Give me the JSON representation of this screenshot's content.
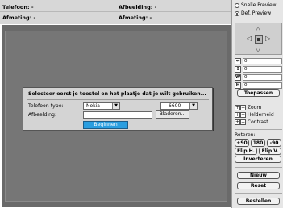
{
  "header": {
    "telefoon_label": "Telefoon: -",
    "afbeelding_label": "Afbeelding: -",
    "afmeting_label": "Afmeting: -",
    "afmeting2_label": "Afmeting: -"
  },
  "dialog": {
    "title": "Selecteer eerst je toestel en het plaatje dat je wilt gebruiken...",
    "type_label": "Telefoon type:",
    "brand_value": "Nokia",
    "model_value": "6600",
    "image_label": "Afbeelding:",
    "image_value": "",
    "browse_label": "Bladeren...",
    "start_label": "Beginnen"
  },
  "panel": {
    "preview_options": [
      {
        "label": "Snelle Preview",
        "selected": false
      },
      {
        "label": "Def. Preview",
        "selected": true
      }
    ],
    "nav_icons": [
      "arrow-up-icon",
      "arrow-left-icon",
      "center-icon",
      "arrow-right-icon",
      "arrow-down-icon"
    ],
    "dims": [
      {
        "icon": "↔",
        "name": "width-offset-icon",
        "value": "0"
      },
      {
        "icon": "↕",
        "name": "height-offset-icon",
        "value": "0"
      },
      {
        "icon": "W",
        "name": "width-icon",
        "value": "0"
      },
      {
        "icon": "H",
        "name": "height-icon",
        "value": "0"
      }
    ],
    "apply_label": "Toepassen",
    "adjust": [
      {
        "label": "Zoom"
      },
      {
        "label": "Helderheid"
      },
      {
        "label": "Contrast"
      }
    ],
    "rotate_label": "Roteren:",
    "rotate_buttons": [
      "+90",
      "180",
      "-90"
    ],
    "flip_buttons": [
      "Flip H.",
      "Flip V."
    ],
    "invert_label": "Inverteren",
    "new_label": "Nieuw",
    "reset_label": "Reset",
    "order_label": "Bestellen"
  },
  "colors": {
    "accent": "#2a9ee0",
    "canvas": "#6a6a6a",
    "header": "#d7d7d7"
  }
}
